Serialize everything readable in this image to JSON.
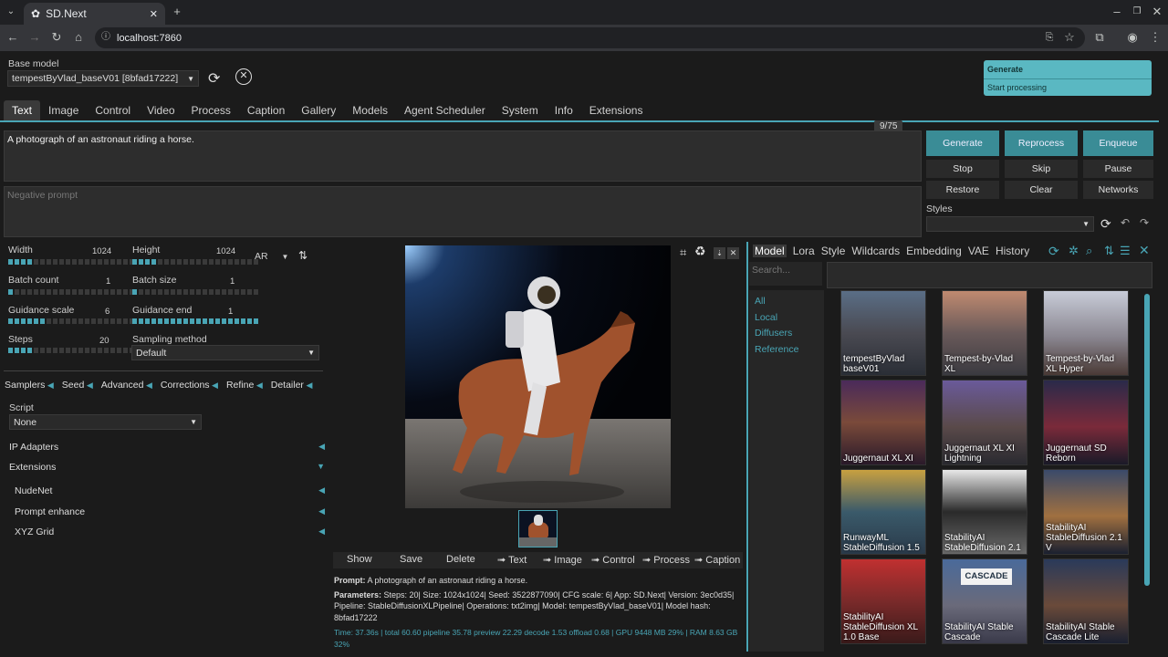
{
  "browser": {
    "tab_title": "SD.Next",
    "url": "localhost:7860"
  },
  "toast": {
    "title": "Generate",
    "message": "Start processing"
  },
  "header": {
    "base_model_label": "Base model",
    "base_model_value": "tempestByVlad_baseV01 [8bfad17222]"
  },
  "main_tabs": [
    "Text",
    "Image",
    "Control",
    "Video",
    "Process",
    "Caption",
    "Gallery",
    "Models",
    "Agent Scheduler",
    "System",
    "Info",
    "Extensions"
  ],
  "prompt": {
    "value": "A photograph of an astronaut riding a horse.",
    "counter": "9/75",
    "negative_placeholder": "Negative prompt"
  },
  "actions": {
    "generate": "Generate",
    "reprocess": "Reprocess",
    "enqueue": "Enqueue",
    "stop": "Stop",
    "skip": "Skip",
    "pause": "Pause",
    "restore": "Restore",
    "clear": "Clear",
    "networks": "Networks",
    "styles_label": "Styles"
  },
  "params": {
    "width_label": "Width",
    "width_value": "1024",
    "width_fill": 0.2,
    "height_label": "Height",
    "height_value": "1024",
    "height_fill": 0.2,
    "ar_label": "AR",
    "batch_count_label": "Batch count",
    "batch_count_value": "1",
    "batch_count_fill": 0.05,
    "batch_size_label": "Batch size",
    "batch_size_value": "1",
    "batch_size_fill": 0.05,
    "guidance_scale_label": "Guidance scale",
    "guidance_scale_value": "6",
    "guidance_scale_fill": 0.3,
    "guidance_end_label": "Guidance end",
    "guidance_end_value": "1",
    "guidance_end_fill": 1.0,
    "steps_label": "Steps",
    "steps_value": "20",
    "steps_fill": 0.2,
    "sampling_label": "Sampling method",
    "sampling_value": "Default"
  },
  "sections": [
    "Samplers",
    "Seed",
    "Advanced",
    "Corrections",
    "Refine",
    "Detailer"
  ],
  "script": {
    "label": "Script",
    "value": "None"
  },
  "accordions": {
    "ip_adapters": "IP Adapters",
    "extensions": "Extensions",
    "nudenet": "NudeNet",
    "prompt_enhance": "Prompt enhance",
    "xyz_grid": "XYZ Grid"
  },
  "gallery_actions": [
    "Show",
    "Save",
    "Delete",
    "➟ Text",
    "➟ Image",
    "➟ Control",
    "➟ Process",
    "➟ Caption"
  ],
  "info": {
    "prompt_label": "Prompt:",
    "prompt_text": " A photograph of an astronaut riding a horse.",
    "params_label": "Parameters:",
    "params_line1": " Steps: 20| Size: 1024x1024| Seed: 3522877090| CFG scale: 6| App: SD.Next| Version: 3ec0d35|",
    "params_line2": "Pipeline: StableDiffusionXLPipeline| Operations: txt2img| Model: tempestByVlad_baseV01| Model hash:",
    "params_line3": "8bfad17222",
    "time_line1": "Time: 37.36s | total 60.60 pipeline 35.78 preview 22.29 decode 1.53 offload 0.68 | GPU 9448 MB 29% | RAM 8.63 GB",
    "time_line2": "32%"
  },
  "networks": {
    "tabs": [
      "Model",
      "Lora",
      "Style",
      "Wildcards",
      "Embedding",
      "VAE",
      "History"
    ],
    "search_placeholder": "Search...",
    "filters": [
      "All",
      "Local",
      "Diffusers",
      "Reference"
    ],
    "cards": [
      {
        "label": "tempestByVlad baseV01"
      },
      {
        "label": "Tempest-by-Vlad XL"
      },
      {
        "label": "Tempest-by-Vlad XL Hyper"
      },
      {
        "label": "Juggernaut XL XI"
      },
      {
        "label": "Juggernaut XL XI Lightning"
      },
      {
        "label": "Juggernaut SD Reborn"
      },
      {
        "label": "RunwayML StableDiffusion 1.5"
      },
      {
        "label": "StabilityAI StableDiffusion 2.1"
      },
      {
        "label": "StabilityAI StableDiffusion 2.1 V"
      },
      {
        "label": "StabilityAI StableDiffusion XL 1.0 Base"
      },
      {
        "label": "StabilityAI Stable Cascade"
      },
      {
        "label": "StabilityAI Stable Cascade Lite"
      }
    ],
    "cascade_sign": "CASCADE"
  },
  "colors": {
    "accent": "#49a5b5",
    "button_teal": "#3a8c96",
    "toast": "#5ab8c2"
  }
}
